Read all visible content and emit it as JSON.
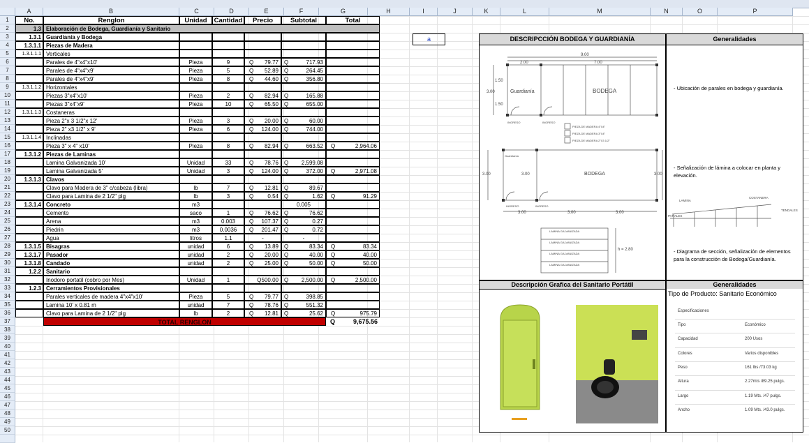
{
  "columns": [
    "A",
    "B",
    "C",
    "D",
    "E",
    "F",
    "G",
    "H",
    "I",
    "J",
    "K",
    "L",
    "M",
    "N",
    "O",
    "P"
  ],
  "header": {
    "no": "No.",
    "renglon": "Renglon",
    "unidad": "Unidad",
    "cantidad": "Cantidad",
    "precio": "Precio",
    "subtotal": "Subtotal",
    "total": "Total"
  },
  "rows": [
    {
      "n": "2",
      "no": "1.3",
      "desc": "Elaboración de Bodega, Guardianía y Sanitario",
      "style": "grey"
    },
    {
      "n": "3",
      "no": "1.3.1",
      "desc": "Guardianía y Bodega",
      "style": "bold"
    },
    {
      "n": "4",
      "no": "1.3.1.1",
      "desc": "Piezas de Madera",
      "style": "bold"
    },
    {
      "n": "5",
      "no": "1.3.1.1.1",
      "desc": "Verticales"
    },
    {
      "n": "6",
      "desc": "Parales de 4\"x4\"x10'",
      "unit": "Pieza",
      "qty": "9",
      "q1": "Q",
      "price": "79.77",
      "q2": "Q",
      "sub": "717.93"
    },
    {
      "n": "7",
      "desc": "Parales de 4\"x4\"x9'",
      "unit": "Pieza",
      "qty": "5",
      "q1": "Q",
      "price": "52.89",
      "q2": "Q",
      "sub": "264.45"
    },
    {
      "n": "8",
      "desc": "Parales de 4\"x4\"x9'",
      "unit": "Pieza",
      "qty": "8",
      "q1": "Q",
      "price": "44.60",
      "q2": "Q",
      "sub": "356.80"
    },
    {
      "n": "9",
      "no": "1.3.1.1.2",
      "desc": "Horizontales"
    },
    {
      "n": "10",
      "desc": "Piezas 3\"x4\"x10'",
      "unit": "Pieza",
      "qty": "2",
      "q1": "Q",
      "price": "82.94",
      "q2": "Q",
      "sub": "165.88"
    },
    {
      "n": "11",
      "desc": "Piezas 3\"x4\"x9'",
      "unit": "Pieza",
      "qty": "10",
      "q1": "Q",
      "price": "65.50",
      "q2": "Q",
      "sub": "655.00"
    },
    {
      "n": "12",
      "no": "1.3.1.1.3",
      "desc": "Costaneras"
    },
    {
      "n": "13",
      "desc": "Pieza 2\"x 3 1/2\"x 12'",
      "unit": "Pieza",
      "qty": "3",
      "q1": "Q",
      "price": "20.00",
      "q2": "Q",
      "sub": "60.00"
    },
    {
      "n": "14",
      "desc": "Pieza 2\" x3 1/2\" x 9'",
      "unit": "Pieza",
      "qty": "6",
      "q1": "Q",
      "price": "124.00",
      "q2": "Q",
      "sub": "744.00"
    },
    {
      "n": "15",
      "no": "1.3.1.1.4",
      "desc": "Inclinadas"
    },
    {
      "n": "16",
      "desc": "Pieza 3\" x 4\" x10'",
      "unit": "Pieza",
      "qty": "8",
      "q1": "Q",
      "price": "82.94",
      "q2": "Q",
      "sub": "663.52",
      "q3": "Q",
      "total": "2,964.06"
    },
    {
      "n": "17",
      "no": "1.3.1.2",
      "desc": "Piezas de Laminas",
      "style": "bold"
    },
    {
      "n": "18",
      "desc": "Lamina Galvanizada 10'",
      "unit": "Unidad",
      "qty": "33",
      "q1": "Q",
      "price": "78.76",
      "q2": "Q",
      "sub": "2,599.08"
    },
    {
      "n": "19",
      "desc": "Lamina Galvanizada 5'",
      "unit": "Unidad",
      "qty": "3",
      "q1": "Q",
      "price": "124.00",
      "q2": "Q",
      "sub": "372.00",
      "q3": "Q",
      "total": "2,971.08"
    },
    {
      "n": "20",
      "no": "1.3.1.3",
      "desc": "Clavos",
      "style": "bold"
    },
    {
      "n": "21",
      "desc": "Clavo para Madera de 3\" c/cabeza (libra)",
      "unit": "lb",
      "qty": "7",
      "q1": "Q",
      "price": "12.81",
      "q2": "Q",
      "sub": "89.67"
    },
    {
      "n": "22",
      "desc": "Clavo para Lamina de 2 1/2\" plg",
      "unit": "lb",
      "qty": "3",
      "q1": "Q",
      "price": "0.54",
      "q2": "Q",
      "sub": "1.62",
      "q3": "Q",
      "total": "91.29"
    },
    {
      "n": "23",
      "no": "1.3.1.4",
      "desc": "Concreto",
      "unit": "m3",
      "subc": "0.005",
      "style": "bold"
    },
    {
      "n": "24",
      "desc": "Cemento",
      "unit": "saco",
      "qty": "1",
      "q1": "Q",
      "price": "76.62",
      "q2": "Q",
      "sub": "76.62"
    },
    {
      "n": "25",
      "desc": "Arena",
      "unit": "m3",
      "qty": "0.003",
      "q1": "Q",
      "price": "107.37",
      "q2": "Q",
      "sub": "0.27"
    },
    {
      "n": "26",
      "desc": "Piedrin",
      "unit": "m3",
      "qty": "0.0036",
      "q1": "Q",
      "price": "201.47",
      "q2": "Q",
      "sub": "0.72"
    },
    {
      "n": "27",
      "desc": "Agua",
      "unit": "litros",
      "qty": "1.1",
      "pricec": "-",
      "subc": "-"
    },
    {
      "n": "28",
      "no": "1.3.1.5",
      "desc": "Bisagras",
      "unit": "unidad",
      "qty": "6",
      "q1": "Q",
      "price": "13.89",
      "q2": "Q",
      "sub": "83.34",
      "q3": "Q",
      "total": "83.34",
      "style": "bold"
    },
    {
      "n": "29",
      "no": "1.3.1.7",
      "desc": "Pasador",
      "unit": "unidad",
      "qty": "2",
      "q1": "Q",
      "price": "20.00",
      "q2": "Q",
      "sub": "40.00",
      "q3": "Q",
      "total": "40.00",
      "style": "bold"
    },
    {
      "n": "30",
      "no": "1.3.1.8",
      "desc": "Candado",
      "unit": "unidad",
      "qty": "2",
      "q1": "Q",
      "price": "25.00",
      "q2": "Q",
      "sub": "50.00",
      "q3": "Q",
      "total": "50.00",
      "style": "bold"
    },
    {
      "n": "31",
      "no": "1.2.2",
      "desc": "Sanitario",
      "style": "bold"
    },
    {
      "n": "32",
      "desc": "Inodoro portatil (cobro por Mes)",
      "unit": "Unidad",
      "qty": "1",
      "price": "Q500.00",
      "q2": "Q",
      "sub": "2,500.00",
      "q3": "Q",
      "total": "2,500.00"
    },
    {
      "n": "33",
      "no": "1.2.3",
      "desc": "Cerramientos Provisionales",
      "style": "bold"
    },
    {
      "n": "34",
      "desc": "Parales verticales de madera 4\"x4\"x10'",
      "unit": "Pieza",
      "qty": "5",
      "q1": "Q",
      "price": "79.77",
      "q2": "Q",
      "sub": "398.85"
    },
    {
      "n": "35",
      "desc": "Lamina 10' x 0.81 m",
      "unit": "unidad",
      "qty": "7",
      "q1": "Q",
      "price": "78.76",
      "q2": "Q",
      "sub": "551.32"
    },
    {
      "n": "36",
      "desc": "Clavo para Lamina de 2 1/2\" plg",
      "unit": "lb",
      "qty": "2",
      "q1": "Q",
      "price": "12.81",
      "q2": "Q",
      "sub": "25.62",
      "q3": "Q",
      "total": "975.79"
    }
  ],
  "total_row": {
    "n": "37",
    "label": "TOTAL RENGLON",
    "q": "Q",
    "value": "9,675.56"
  },
  "empty_rows": [
    "1",
    "38",
    "39",
    "40",
    "41",
    "42",
    "43",
    "44",
    "45",
    "46",
    "47",
    "48",
    "49",
    "50"
  ],
  "button_label": "a",
  "panel1": {
    "title": "DESCRIPCCIÓN BODEGA Y GUARDIANÍA",
    "gen_title": "Generalidades",
    "notes": [
      "- Ubicación de parales en bodega y guardianía.",
      "- Señalización de lámina a colocar en planta y elevación.",
      "- Diagrama de sección, señalización de elementos para la construcción de Bodega/Guardianía."
    ],
    "plan_labels": {
      "guardiania": "Guardianía",
      "bodega": "BODEGA",
      "bodega2": "BODEGA",
      "guardiania2": "Guardianía",
      "d900": "9.00",
      "d200": "2.00",
      "d700": "7.00",
      "d300": "3.00",
      "d150": "1.50",
      "ingreso": "INGRESO",
      "lamina": "LAMINA",
      "costanera": "COSTANERA",
      "tendales": "TENDALES",
      "parales": "PARALES",
      "lamgalv": "LAMINA GALVANIZADA",
      "h": "h = 2.80"
    },
    "legend": [
      "PIEZA DE MADERA 4\"X4\"",
      "PIEZA DE MADERA 3\"X4\"",
      "PIEZA DE MADERA 2\"X3 1/2\""
    ]
  },
  "panel2": {
    "title": "Descripción Grafica del Sanitario Portátil",
    "gen_title": "Generalidades",
    "product": "Tipo de Producto: Sanitario Económico",
    "specs_header": "Especificaciones",
    "specs": [
      {
        "k": "Tipo",
        "v": "Económico"
      },
      {
        "k": "Capacidad",
        "v": "200 Usos"
      },
      {
        "k": "Colores",
        "v": "Varios disponibles"
      },
      {
        "k": "Peso",
        "v": "161 lbs /73.03 kg"
      },
      {
        "k": "Altura",
        "v": "2.27mts /89.25 pulgs."
      },
      {
        "k": "Largo",
        "v": "1.19 Mts. /47 pulgs."
      },
      {
        "k": "Ancho",
        "v": "1.09 Mts. /43.0 pulgs."
      }
    ]
  },
  "colors": {
    "header_bg": "#e4ecf7",
    "grey_row": "#bfbfbf",
    "total_red": "#c00000",
    "toilet_green": "#b8d44a"
  }
}
